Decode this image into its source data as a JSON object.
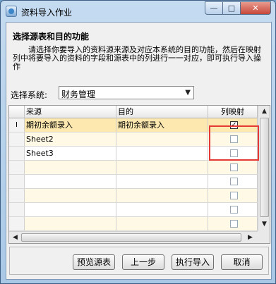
{
  "window": {
    "title": "资料导入作业",
    "min_glyph": "—",
    "max_glyph": "□",
    "close_glyph": "✕"
  },
  "heading": "选择源表和目的功能",
  "description": "请选择你要导入的资料源来源及对应本系统的目的功能，然后在映射列中将要导入的资料的字段和源表中的列进行一一对应，即可执行导入操作",
  "system": {
    "label": "选择系统:",
    "value": "财务管理",
    "arrow": "▼"
  },
  "table": {
    "columns": [
      "来源",
      "目的",
      "列映射"
    ],
    "rows": [
      {
        "indicator": "I",
        "source": "期初余额录入",
        "target": "期初余额录入",
        "mapped": true,
        "mark": "✓"
      },
      {
        "indicator": "",
        "source": "Sheet2",
        "target": "",
        "mapped": false,
        "mark": ""
      },
      {
        "indicator": "",
        "source": "Sheet3",
        "target": "",
        "mapped": false,
        "mark": ""
      },
      {
        "indicator": "",
        "source": "",
        "target": "",
        "mapped": false,
        "mark": ""
      },
      {
        "indicator": "",
        "source": "",
        "target": "",
        "mapped": false,
        "mark": ""
      },
      {
        "indicator": "",
        "source": "",
        "target": "",
        "mapped": false,
        "mark": ""
      },
      {
        "indicator": "",
        "source": "",
        "target": "",
        "mapped": false,
        "mark": ""
      },
      {
        "indicator": "",
        "source": "",
        "target": "",
        "mapped": false,
        "mark": ""
      }
    ],
    "scroll_up": "▲",
    "scroll_down": "▼",
    "scroll_left": "◀",
    "scroll_right": "▶"
  },
  "buttons": {
    "preview": "预览源表",
    "previous": "上一步",
    "execute": "执行导入",
    "cancel": "取消"
  },
  "colors": {
    "highlight": "#e53935",
    "selected_row": "#fde9b0",
    "alt_row": "#fff9e6"
  }
}
